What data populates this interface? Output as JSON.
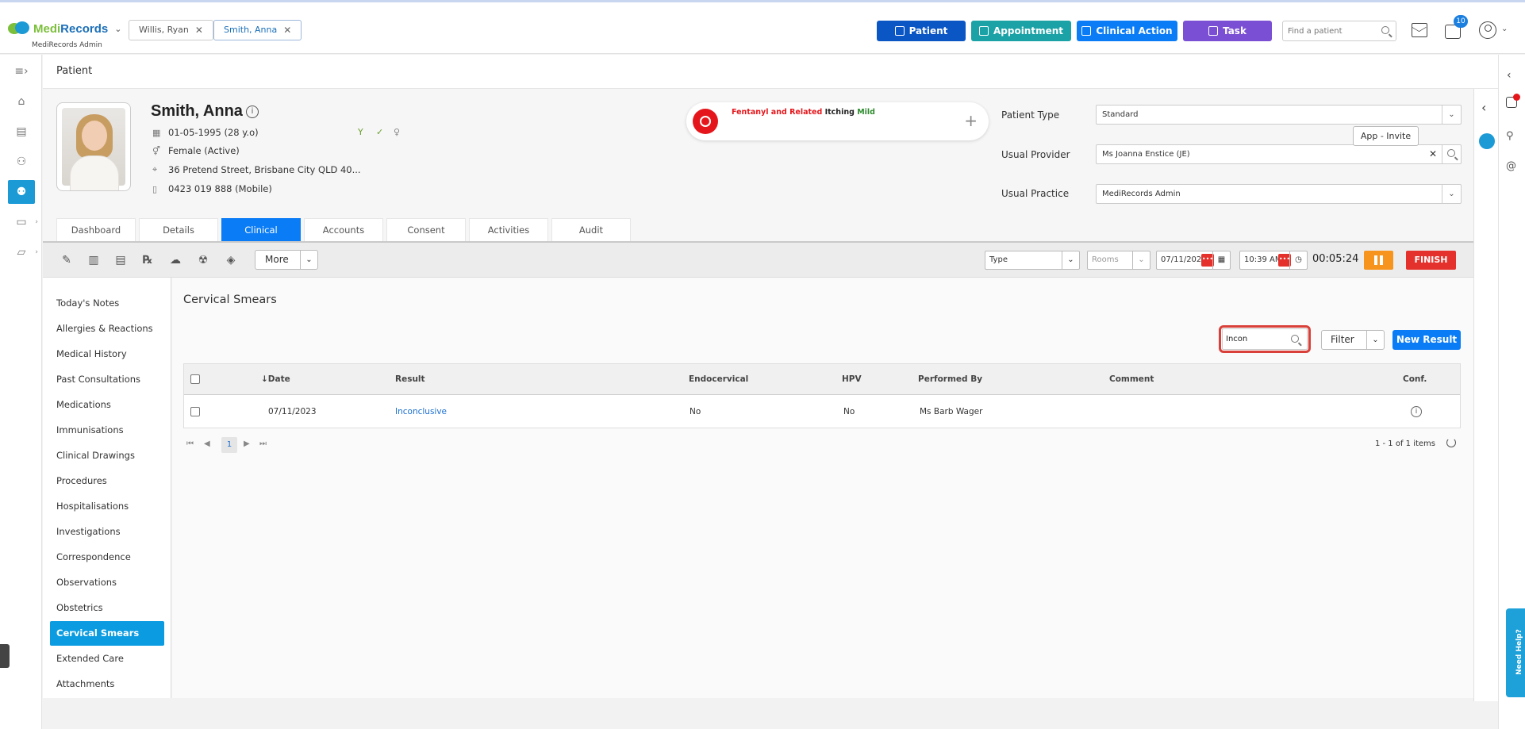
{
  "app": {
    "brand_part1": "Medi",
    "brand_part2": "Records",
    "org": "MediRecords Admin",
    "colors": {
      "brand_green": "#7bbf3a",
      "brand_blue": "#1b6fb8",
      "primary": "#0a7cf5",
      "finish": "#e5312b",
      "pause": "#f7941d"
    }
  },
  "open_patients": [
    {
      "name": "Willis, Ryan",
      "active": false
    },
    {
      "name": "Smith, Anna",
      "active": true
    }
  ],
  "top_actions": [
    {
      "label": "Patient",
      "color": "#0a56c4",
      "icon": "person-icon"
    },
    {
      "label": "Appointment",
      "color": "#1aa2a6",
      "icon": "calendar-icon"
    },
    {
      "label": "Clinical Action",
      "color": "#0a7cf5",
      "icon": "medical-kit-icon"
    },
    {
      "label": "Task",
      "color": "#7b4fd3",
      "icon": "clipboard-icon"
    }
  ],
  "search": {
    "placeholder": "Find a patient"
  },
  "notifications": {
    "task_count": "10"
  },
  "help": {
    "label": "Need Help?"
  },
  "page": {
    "title": "Patient"
  },
  "patient": {
    "name": "Smith, Anna",
    "dob": "01-05-1995 (28 y.o)",
    "gender": "Female (Active)",
    "address": "36 Pretend Street, Brisbane City QLD 40...",
    "phone": "0423 019 888 (Mobile)"
  },
  "allergy": {
    "substance": "Fentanyl and Related",
    "reaction": "Itching",
    "severity": "Mild"
  },
  "fields": {
    "patient_type_label": "Patient Type",
    "patient_type_value": "Standard",
    "usual_provider_label": "Usual Provider",
    "usual_provider_value": "Ms Joanna Enstice (JE)",
    "usual_practice_label": "Usual Practice",
    "usual_practice_value": "MediRecords Admin",
    "app_invite": "App - Invite"
  },
  "tabs": [
    {
      "label": "Dashboard",
      "active": false
    },
    {
      "label": "Details",
      "active": false
    },
    {
      "label": "Clinical",
      "active": true
    },
    {
      "label": "Accounts",
      "active": false
    },
    {
      "label": "Consent",
      "active": false
    },
    {
      "label": "Activities",
      "active": false
    },
    {
      "label": "Audit",
      "active": false
    }
  ],
  "toolbar": {
    "more": "More",
    "type": "Type",
    "rooms": "Rooms",
    "date": "07/11/2023",
    "time": "10:39 AM",
    "timer": "00:05:24",
    "finish": "FINISH"
  },
  "clinical_menu": [
    "Today's Notes",
    "Allergies & Reactions",
    "Medical History",
    "Past Consultations",
    "Medications",
    "Immunisations",
    "Clinical Drawings",
    "Procedures",
    "Hospitalisations",
    "Investigations",
    "Correspondence",
    "Observations",
    "Obstetrics",
    "Cervical Smears",
    "Extended Care",
    "Attachments"
  ],
  "clinical_menu_active": "Cervical Smears",
  "section": {
    "title": "Cervical Smears",
    "search_value": "Incon",
    "filter": "Filter",
    "new_result": "New Result"
  },
  "table": {
    "columns": [
      "↓Date",
      "Result",
      "Endocervical",
      "HPV",
      "Performed By",
      "Comment",
      "Conf."
    ],
    "rows": [
      {
        "date": "07/11/2023",
        "result": "Inconclusive",
        "endocervical": "No",
        "hpv": "No",
        "performed_by": "Ms Barb Wager",
        "comment": ""
      }
    ]
  },
  "pager": {
    "current_page": "1",
    "summary": "1 - 1 of 1 items"
  }
}
